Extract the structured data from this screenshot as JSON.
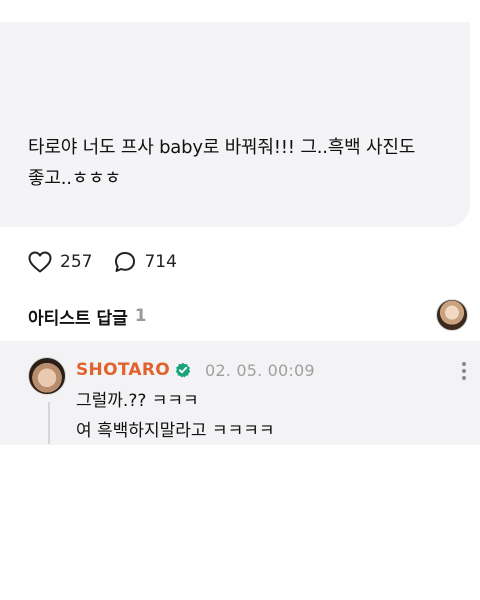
{
  "post": {
    "line1": "타로야 너도 프사 baby로 바꿔줘!!! 그..흑백 사진도",
    "line2": "좋고..ㅎㅎㅎ"
  },
  "stats": {
    "likes": "257",
    "comments": "714"
  },
  "artist_replies": {
    "title": "아티스트 답글",
    "count": "1"
  },
  "reply": {
    "author": "SHOTARO",
    "timestamp": "02. 05. 00:09",
    "line1": "그럴까.??  ㅋㅋㅋ",
    "line2": "여 흑백하지말라고 ㅋㅋㅋㅋ"
  },
  "colors": {
    "author": "#e0632e",
    "verified": "#1aa37a",
    "card_bg": "#f4f4f6",
    "muted": "#a0a0a0"
  },
  "icons": {
    "like": "heart-icon",
    "comment": "speech-bubble-icon",
    "verified": "verified-check-icon",
    "more": "more-vertical-icon"
  }
}
